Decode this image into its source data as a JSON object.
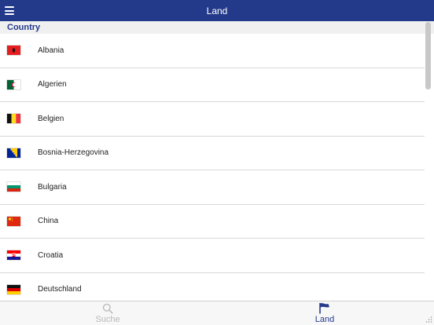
{
  "header": {
    "title": "Land"
  },
  "section": {
    "title": "Country"
  },
  "countries": [
    {
      "name": "Albania",
      "flag": "albania-flag-icon"
    },
    {
      "name": "Algerien",
      "flag": "algeria-flag-icon"
    },
    {
      "name": "Belgien",
      "flag": "belgium-flag-icon"
    },
    {
      "name": "Bosnia-Herzegovina",
      "flag": "bosnia-flag-icon"
    },
    {
      "name": "Bulgaria",
      "flag": "bulgaria-flag-icon"
    },
    {
      "name": "China",
      "flag": "china-flag-icon"
    },
    {
      "name": "Croatia",
      "flag": "croatia-flag-icon"
    },
    {
      "name": "Deutschland",
      "flag": "germany-flag-icon"
    }
  ],
  "tabs": [
    {
      "label": "Suche",
      "icon": "search-icon",
      "active": false
    },
    {
      "label": "Land",
      "icon": "flag-icon",
      "active": true
    }
  ],
  "colors": {
    "accent": "#233a8b",
    "inactive": "#b8b8b8"
  }
}
